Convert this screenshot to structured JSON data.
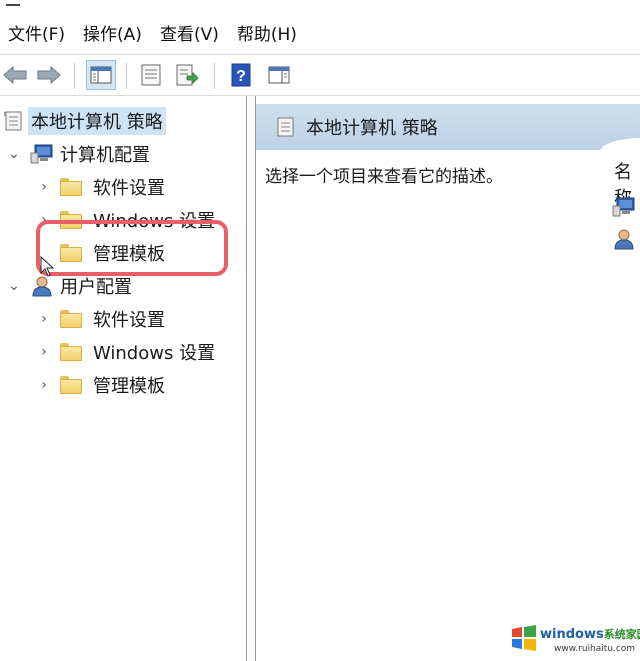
{
  "menu": [
    {
      "label": "文件(F)"
    },
    {
      "label": "操作(A)"
    },
    {
      "label": "查看(V)"
    },
    {
      "label": "帮助(H)"
    }
  ],
  "toolbar": {
    "help_glyph": "?"
  },
  "tree": {
    "root": {
      "label": "本地计算机 策略",
      "icon": "policy-document-icon"
    },
    "computer_config": {
      "label": "计算机配置",
      "icon": "computer-icon",
      "children": [
        {
          "label": "软件设置"
        },
        {
          "label": "Windows 设置"
        },
        {
          "label": "管理模板"
        }
      ]
    },
    "user_config": {
      "label": "用户配置",
      "icon": "user-icon",
      "children": [
        {
          "label": "软件设置"
        },
        {
          "label": "Windows 设置"
        },
        {
          "label": "管理模板"
        }
      ]
    }
  },
  "right_pane": {
    "header_title": "本地计算机 策略",
    "description": "选择一个项目来查看它的描述。",
    "column_header": "名称"
  },
  "watermark": {
    "brand": "windows",
    "brand_cn": "系统家园",
    "url": "www.ruihaitu.com"
  },
  "colors": {
    "selection": "#cfe3f7",
    "highlight_box": "#e85f67",
    "header_band": "#c6d9ec"
  }
}
